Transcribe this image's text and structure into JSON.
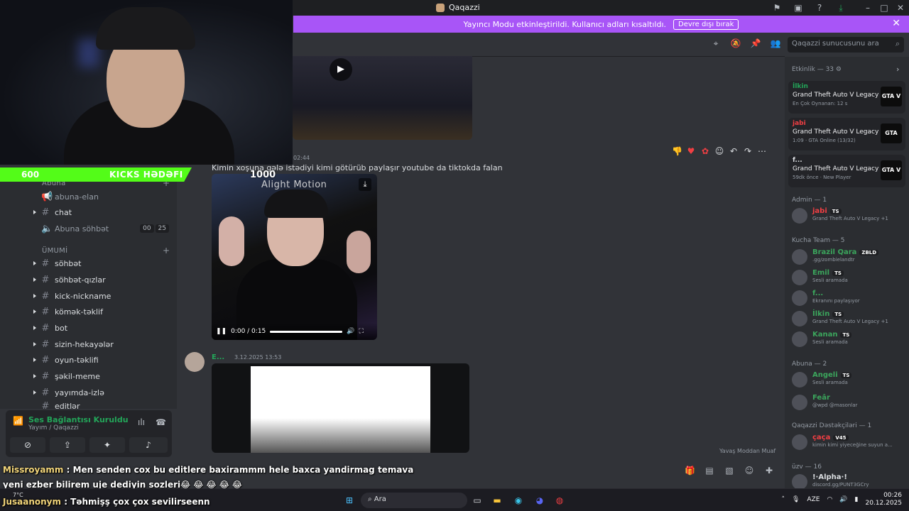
{
  "window": {
    "title": "Qaqazzi"
  },
  "banner": {
    "message": "Yayıncı Modu etkinleştirildi. Kullanıcı adları kısaltıldı.",
    "button_label": "Devre dışı bırak"
  },
  "stream": {
    "kicks_current": "600",
    "kicks_label": "KICKS HƏDƏFI",
    "kicks_target": "1000"
  },
  "sidebar": {
    "categories": [
      {
        "label": "Abuna"
      },
      {
        "label": "ÜMUMİ"
      }
    ],
    "channels": [
      {
        "label": "abuna-elan"
      },
      {
        "label": "chat"
      },
      {
        "label": "Abuna söhbət",
        "badge_a": "00",
        "badge_b": "25"
      },
      {
        "label": "söhbət"
      },
      {
        "label": "söhbət-qızlar"
      },
      {
        "label": "kick-nickname"
      },
      {
        "label": "kömək-təklif"
      },
      {
        "label": "bot"
      },
      {
        "label": "sizin-hekayələr"
      },
      {
        "label": "oyun-təklifi"
      },
      {
        "label": "şəkil-meme"
      },
      {
        "label": "yayımda-izlə"
      },
      {
        "label": "editlər"
      }
    ]
  },
  "voice": {
    "status": "Ses Bağlantısı Kuruldu",
    "channel": "Yayım / Qaqazzi"
  },
  "search": {
    "placeholder": "Qaqazzi sunucusunu ara"
  },
  "messages": {
    "time1": "02:44",
    "text1": "Kimin xoşuna gələ istədiyi kimi götürüb paylaşır youtube da tiktokda falan",
    "video_watermark": "Alight Motion",
    "video_time": "0:00 / 0:15",
    "video_progress": 1.0,
    "author2": "E...",
    "time2": "3.12.2025 13:53",
    "slowmode": "Yavaş Moddan Muaf"
  },
  "members": {
    "activity_header": "Etkinlik — 33",
    "activities": [
      {
        "user": "İlkin",
        "user_color": "#23a559",
        "game": "Grand Theft Auto V Legacy",
        "meta": "En Çok Oynanan: 12 s",
        "badge": "GTA V"
      },
      {
        "user": "jabi",
        "user_color": "#f23f43",
        "game": "Grand Theft Auto V Legacy",
        "meta": "1:09 · GTA Online (13/32)",
        "badge": "GTA"
      },
      {
        "user": "f...",
        "user_color": "#dbdee1",
        "game": "Grand Theft Auto V Legacy",
        "meta": "59dk önce · New Player",
        "badge": "GTA V"
      }
    ],
    "groups": [
      {
        "label": "Admin — 1"
      },
      {
        "label": "Kucha Team — 5"
      },
      {
        "label": "Abuna — 2"
      },
      {
        "label": "Qaqazzi Dəstəkçiləri — 1"
      },
      {
        "label": "üzv — 16"
      }
    ],
    "people": [
      {
        "name": "jabi",
        "tag": "TS",
        "status": "Grand Theft Auto V Legacy +1",
        "color": "#f23f43"
      },
      {
        "name": "Brazil Qara",
        "tag": "ZBLD",
        "status": ".gg/zombielandtr",
        "color": "#3ba55c"
      },
      {
        "name": "Emil",
        "tag": "TS",
        "status": "Sesli aramada",
        "color": "#3ba55c"
      },
      {
        "name": "f...",
        "tag": "",
        "status": "Ekranını paylaşıyor",
        "color": "#3ba55c"
      },
      {
        "name": "İlkin",
        "tag": "TS",
        "status": "Grand Theft Auto V Legacy +1",
        "color": "#3ba55c"
      },
      {
        "name": "Kanan",
        "tag": "TS",
        "status": "Sesli aramada",
        "color": "#3ba55c"
      },
      {
        "name": "Angeli",
        "tag": "TS",
        "status": "Sesli aramada",
        "color": "#3ba55c"
      },
      {
        "name": "Feâr",
        "tag": "",
        "status": "@wpd @masonlar",
        "color": "#3ba55c"
      },
      {
        "name": "çaça",
        "tag": "V45",
        "status": "kimin kimi yiyeceğine suyun a...",
        "color": "#f23f43"
      },
      {
        "name": "!·Alpha·!",
        "tag": "",
        "status": "discord.gg/PUNT3GCry",
        "color": "#f2f3f5"
      }
    ]
  },
  "kick_chat": [
    {
      "user": "Missroyamm",
      "text": "Men senden cox bu editlere baxirammm hele baxca yandirmag temava"
    },
    {
      "user": "",
      "text": "yeni ezber bilirem uje dediyin sozleri😂 😂 😂 😂 😂"
    },
    {
      "user": "Jusaanonym",
      "text": "Təhmişş çox çox sevilirseenn"
    }
  ],
  "taskbar": {
    "search": "Ara",
    "weather": "7°C",
    "lang": "AZE",
    "time": "00:26",
    "date": "20.12.2025"
  }
}
